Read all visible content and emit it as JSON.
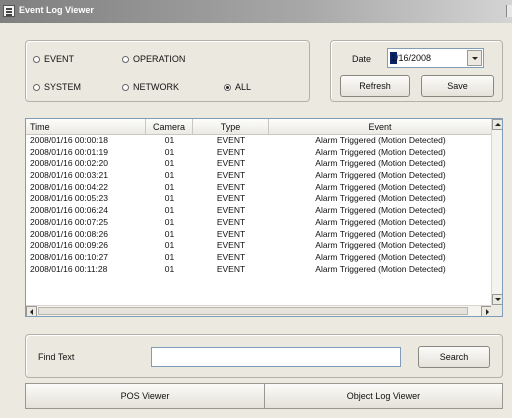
{
  "window": {
    "title": "Event Log Viewer"
  },
  "filters": {
    "options": [
      {
        "id": "event",
        "label": "EVENT",
        "checked": false
      },
      {
        "id": "operation",
        "label": "OPERATION",
        "checked": false
      },
      {
        "id": "system",
        "label": "SYSTEM",
        "checked": false
      },
      {
        "id": "network",
        "label": "NETWORK",
        "checked": false
      },
      {
        "id": "all",
        "label": "ALL",
        "checked": true
      }
    ]
  },
  "date_panel": {
    "label": "Date",
    "value": "1/16/2008",
    "refresh_label": "Refresh",
    "save_label": "Save"
  },
  "log_table": {
    "columns": [
      "Time",
      "Camera",
      "Type",
      "Event"
    ],
    "rows": [
      [
        "2008/01/16 00:00:18",
        "01",
        "EVENT",
        "Alarm Triggered (Motion Detected)"
      ],
      [
        "2008/01/16 00:01:19",
        "01",
        "EVENT",
        "Alarm Triggered (Motion Detected)"
      ],
      [
        "2008/01/16 00:02:20",
        "01",
        "EVENT",
        "Alarm Triggered (Motion Detected)"
      ],
      [
        "2008/01/16 00:03:21",
        "01",
        "EVENT",
        "Alarm Triggered (Motion Detected)"
      ],
      [
        "2008/01/16 00:04:22",
        "01",
        "EVENT",
        "Alarm Triggered (Motion Detected)"
      ],
      [
        "2008/01/16 00:05:23",
        "01",
        "EVENT",
        "Alarm Triggered (Motion Detected)"
      ],
      [
        "2008/01/16 00:06:24",
        "01",
        "EVENT",
        "Alarm Triggered (Motion Detected)"
      ],
      [
        "2008/01/16 00:07:25",
        "01",
        "EVENT",
        "Alarm Triggered (Motion Detected)"
      ],
      [
        "2008/01/16 00:08:26",
        "01",
        "EVENT",
        "Alarm Triggered (Motion Detected)"
      ],
      [
        "2008/01/16 00:09:26",
        "01",
        "EVENT",
        "Alarm Triggered (Motion Detected)"
      ],
      [
        "2008/01/16 00:10:27",
        "01",
        "EVENT",
        "Alarm Triggered (Motion Detected)"
      ],
      [
        "2008/01/16 00:11:28",
        "01",
        "EVENT",
        "Alarm Triggered (Motion Detected)"
      ]
    ]
  },
  "find": {
    "label": "Find Text",
    "value": "",
    "search_label": "Search"
  },
  "bottom_tabs": {
    "pos_viewer": "POS Viewer",
    "object_log_viewer": "Object Log Viewer"
  }
}
